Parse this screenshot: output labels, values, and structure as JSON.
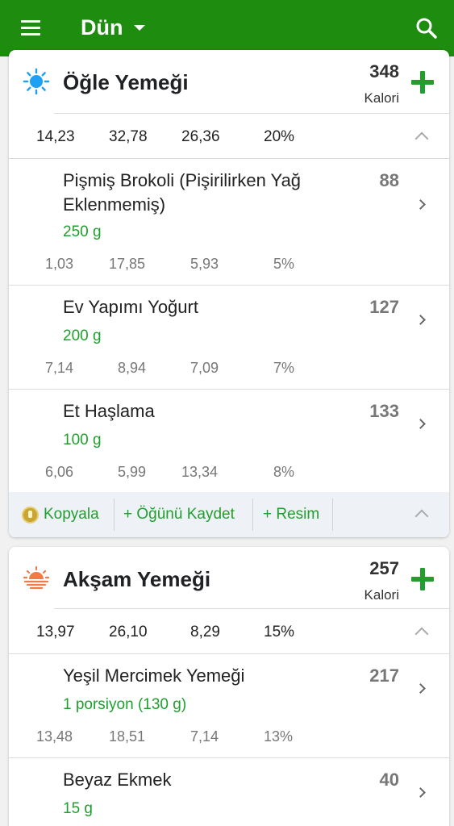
{
  "header": {
    "title": "Dün"
  },
  "meals": [
    {
      "title": "Öğle Yemeği",
      "calories": "348",
      "calories_unit": "Kalori",
      "macros": [
        "14,23",
        "32,78",
        "26,36",
        "20%"
      ],
      "items": [
        {
          "name": "Pişmiş  Brokoli (Pişirilirken Yağ Eklenmemiş)",
          "qty": "250 g",
          "cal": "88",
          "macros": [
            "1,03",
            "17,85",
            "5,93",
            "5%"
          ]
        },
        {
          "name": "Ev Yapımı Yoğurt",
          "qty": "200 g",
          "cal": "127",
          "macros": [
            "7,14",
            "8,94",
            "7,09",
            "7%"
          ]
        },
        {
          "name": "Et Haşlama",
          "qty": "100 g",
          "cal": "133",
          "macros": [
            "6,06",
            "5,99",
            "13,34",
            "8%"
          ]
        }
      ],
      "actions": {
        "copy": "Kopyala",
        "save": "+ Öğünü Kaydet",
        "photo": "+ Resim"
      }
    },
    {
      "title": "Akşam Yemeği",
      "calories": "257",
      "calories_unit": "Kalori",
      "macros": [
        "13,97",
        "26,10",
        "8,29",
        "15%"
      ],
      "items": [
        {
          "name": "Yeşil Mercimek Yemeği",
          "qty": "1 porsiyon (130 g)",
          "cal": "217",
          "macros": [
            "13,48",
            "18,51",
            "7,14",
            "13%"
          ]
        },
        {
          "name": "Beyaz Ekmek",
          "qty": "15 g",
          "cal": "40",
          "macros": []
        }
      ]
    }
  ],
  "colors": {
    "brand_green": "#1e8c0f",
    "accent_green": "#1fa02e",
    "sun_blue": "#1ea1f2",
    "sunset_orange": "#f07a4a"
  },
  "icons": {
    "menu": "hamburger-menu-icon",
    "search": "search-icon",
    "add": "plus-icon",
    "lunch": "sun-icon",
    "dinner": "sunset-icon",
    "copy": "coin-icon"
  }
}
